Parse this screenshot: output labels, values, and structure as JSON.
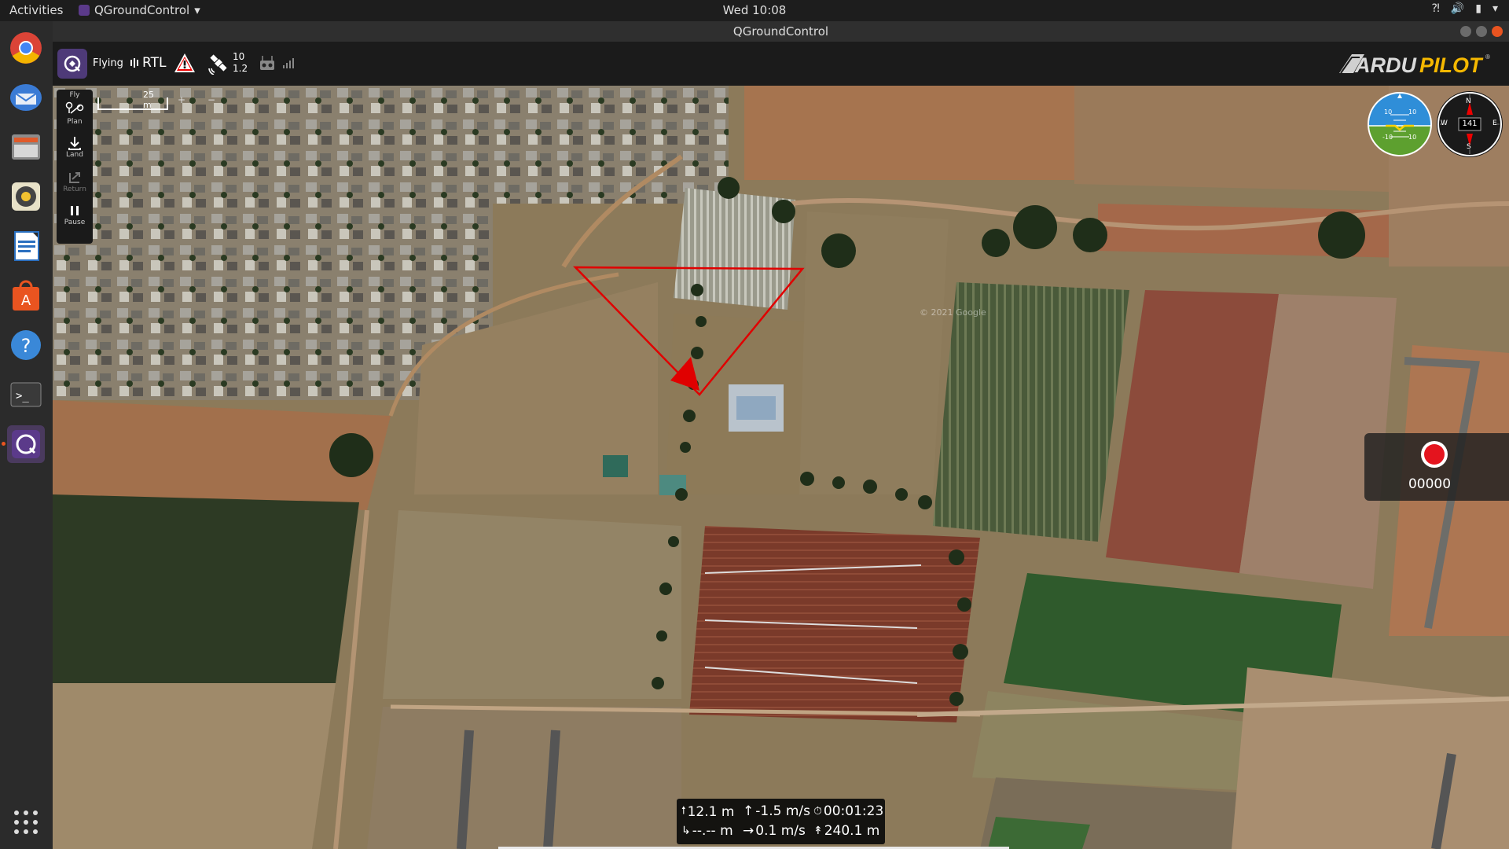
{
  "desktop": {
    "activities_label": "Activities",
    "app_menu_label": "QGroundControl",
    "clock": "Wed 10:08"
  },
  "window": {
    "title": "QGroundControl"
  },
  "toolbar": {
    "flight_state": "Flying",
    "flight_mode": "RTL",
    "gps_satellite_count": "10",
    "gps_hdop": "1.2",
    "brand": "ARDUPILOT"
  },
  "tools": {
    "fly_label": "Fly",
    "plan_label": "Plan",
    "land_label": "Land",
    "return_label": "Return",
    "pause_label": "Pause"
  },
  "map": {
    "scale_label": "25 m",
    "zoom_in": "+",
    "zoom_out": "−",
    "watermark": "© 2021 Google"
  },
  "attitude": {
    "pitch_top_left": "10",
    "pitch_top_right": "10",
    "pitch_bottom_left": "-10",
    "pitch_bottom_right": "10"
  },
  "compass": {
    "heading": "141",
    "north": "N",
    "east": "E",
    "south": "S",
    "west": "W"
  },
  "recording": {
    "counter": "00000"
  },
  "telemetry": {
    "altitude": "12.1 m",
    "vertical_speed": "-1.5 m/s",
    "flight_time": "00:01:23",
    "distance_to_home": "--.-- m",
    "ground_speed": "0.1 m/s",
    "total_distance": "240.1 m"
  },
  "colors": {
    "accent": "#e95420",
    "qgc_purple": "#4e3a78",
    "mission_line": "#e00000",
    "record_red": "#e4141e",
    "ardupilot_yellow": "#f5b800"
  }
}
